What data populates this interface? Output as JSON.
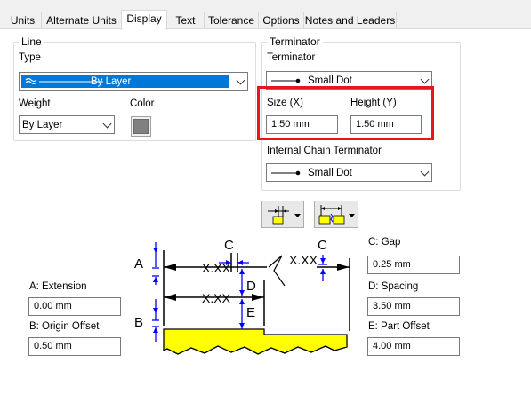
{
  "tabs": [
    {
      "label": "Units"
    },
    {
      "label": "Alternate Units"
    },
    {
      "label": "Display"
    },
    {
      "label": "Text"
    },
    {
      "label": "Tolerance"
    },
    {
      "label": "Options"
    },
    {
      "label": "Notes and Leaders"
    }
  ],
  "active_tab": "Display",
  "line": {
    "group_label": "Line",
    "type_label": "Type",
    "type_value": "By Layer",
    "weight_label": "Weight",
    "weight_value": "By Layer",
    "color_label": "Color",
    "color_swatch": "#808080"
  },
  "terminator": {
    "group_label": "Terminator",
    "terminator_label": "Terminator",
    "terminator_value": "Small Dot",
    "size_label": "Size (X)",
    "size_value": "1.50 mm",
    "height_label": "Height (Y)",
    "height_value": "1.50 mm",
    "internal_label": "Internal Chain Terminator",
    "internal_value": "Small Dot",
    "highlight_color": "#e8161c"
  },
  "diagram": {
    "letter_a": "A",
    "letter_b": "B",
    "letter_c1": "C",
    "letter_c2": "C",
    "letter_d": "D",
    "letter_e": "E",
    "dim1": "X.XX",
    "dim2": "X.XX",
    "dim3": "X.XX",
    "arrow_color": "#0000ff",
    "part_color": "#ffff00"
  },
  "fields": {
    "extension_label": "A: Extension",
    "extension_value": "0.00 mm",
    "origin_label": "B: Origin Offset",
    "origin_value": "0.50 mm",
    "gap_label": "C: Gap",
    "gap_value": "0.25 mm",
    "spacing_label": "D: Spacing",
    "spacing_value": "3.50 mm",
    "part_label": "E: Part Offset",
    "part_value": "4.00 mm"
  }
}
